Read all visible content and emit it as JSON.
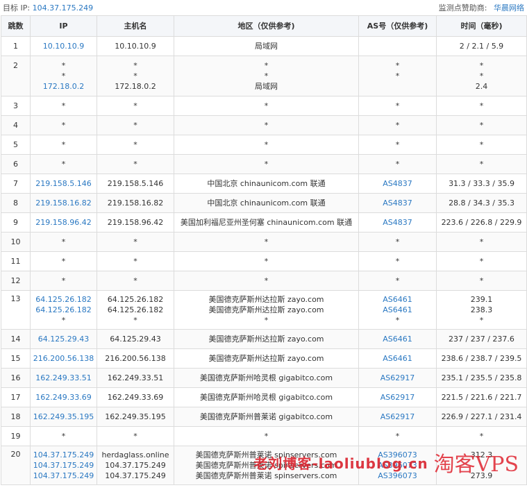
{
  "header": {
    "target_label": "目标 IP:",
    "target_ip": "104.37.175.249",
    "sponsor_label": "监测点赞助商:",
    "sponsor_name": "华晨网络"
  },
  "table": {
    "columns": [
      "跳数",
      "IP",
      "主机名",
      "地区（仅供参考)",
      "AS号（仅供参考)",
      "时间（毫秒)"
    ],
    "rows": [
      {
        "hop": "1",
        "ip": [
          "10.10.10.9"
        ],
        "host": [
          "10.10.10.9"
        ],
        "region": [
          "局域网"
        ],
        "as": [
          ""
        ],
        "time": [
          "2 / 2.1 / 5.9"
        ]
      },
      {
        "hop": "2",
        "ip": [
          "*",
          "*",
          "172.18.0.2"
        ],
        "host": [
          "*",
          "*",
          "172.18.0.2"
        ],
        "region": [
          "*",
          "*",
          "局域网"
        ],
        "as": [
          "*",
          "*",
          ""
        ],
        "time": [
          "*",
          "*",
          "2.4"
        ]
      },
      {
        "hop": "3",
        "ip": [
          "*"
        ],
        "host": [
          "*"
        ],
        "region": [
          "*"
        ],
        "as": [
          "*"
        ],
        "time": [
          "*"
        ]
      },
      {
        "hop": "4",
        "ip": [
          "*"
        ],
        "host": [
          "*"
        ],
        "region": [
          "*"
        ],
        "as": [
          "*"
        ],
        "time": [
          "*"
        ]
      },
      {
        "hop": "5",
        "ip": [
          "*"
        ],
        "host": [
          "*"
        ],
        "region": [
          "*"
        ],
        "as": [
          "*"
        ],
        "time": [
          "*"
        ]
      },
      {
        "hop": "6",
        "ip": [
          "*"
        ],
        "host": [
          "*"
        ],
        "region": [
          "*"
        ],
        "as": [
          "*"
        ],
        "time": [
          "*"
        ]
      },
      {
        "hop": "7",
        "ip": [
          "219.158.5.146"
        ],
        "host": [
          "219.158.5.146"
        ],
        "region": [
          "中国北京 chinaunicom.com 联通"
        ],
        "as": [
          "AS4837"
        ],
        "time": [
          "31.3 / 33.3 / 35.9"
        ]
      },
      {
        "hop": "8",
        "ip": [
          "219.158.16.82"
        ],
        "host": [
          "219.158.16.82"
        ],
        "region": [
          "中国北京 chinaunicom.com 联通"
        ],
        "as": [
          "AS4837"
        ],
        "time": [
          "28.8 / 34.3 / 35.3"
        ]
      },
      {
        "hop": "9",
        "ip": [
          "219.158.96.42"
        ],
        "host": [
          "219.158.96.42"
        ],
        "region": [
          "美国加利福尼亚州圣何塞 chinaunicom.com 联通"
        ],
        "as": [
          "AS4837"
        ],
        "time": [
          "223.6 / 226.8 / 229.9"
        ]
      },
      {
        "hop": "10",
        "ip": [
          "*"
        ],
        "host": [
          "*"
        ],
        "region": [
          "*"
        ],
        "as": [
          "*"
        ],
        "time": [
          "*"
        ]
      },
      {
        "hop": "11",
        "ip": [
          "*"
        ],
        "host": [
          "*"
        ],
        "region": [
          "*"
        ],
        "as": [
          "*"
        ],
        "time": [
          "*"
        ]
      },
      {
        "hop": "12",
        "ip": [
          "*"
        ],
        "host": [
          "*"
        ],
        "region": [
          "*"
        ],
        "as": [
          "*"
        ],
        "time": [
          "*"
        ]
      },
      {
        "hop": "13",
        "ip": [
          "64.125.26.182",
          "64.125.26.182",
          "*"
        ],
        "host": [
          "64.125.26.182",
          "64.125.26.182",
          "*"
        ],
        "region": [
          "美国德克萨斯州达拉斯 zayo.com",
          "美国德克萨斯州达拉斯 zayo.com",
          "*"
        ],
        "as": [
          "AS6461",
          "AS6461",
          "*"
        ],
        "time": [
          "239.1",
          "238.3",
          "*"
        ]
      },
      {
        "hop": "14",
        "ip": [
          "64.125.29.43"
        ],
        "host": [
          "64.125.29.43"
        ],
        "region": [
          "美国德克萨斯州达拉斯 zayo.com"
        ],
        "as": [
          "AS6461"
        ],
        "time": [
          "237 / 237 / 237.6"
        ]
      },
      {
        "hop": "15",
        "ip": [
          "216.200.56.138"
        ],
        "host": [
          "216.200.56.138"
        ],
        "region": [
          "美国德克萨斯州达拉斯 zayo.com"
        ],
        "as": [
          "AS6461"
        ],
        "time": [
          "238.6 / 238.7 / 239.5"
        ]
      },
      {
        "hop": "16",
        "ip": [
          "162.249.33.51"
        ],
        "host": [
          "162.249.33.51"
        ],
        "region": [
          "美国德克萨斯州哈灵根 gigabitco.com"
        ],
        "as": [
          "AS62917"
        ],
        "time": [
          "235.1 / 235.5 / 235.8"
        ]
      },
      {
        "hop": "17",
        "ip": [
          "162.249.33.69"
        ],
        "host": [
          "162.249.33.69"
        ],
        "region": [
          "美国德克萨斯州哈灵根 gigabitco.com"
        ],
        "as": [
          "AS62917"
        ],
        "time": [
          "221.5 / 221.6 / 221.7"
        ]
      },
      {
        "hop": "18",
        "ip": [
          "162.249.35.195"
        ],
        "host": [
          "162.249.35.195"
        ],
        "region": [
          "美国德克萨斯州普莱诺 gigabitco.com"
        ],
        "as": [
          "AS62917"
        ],
        "time": [
          "226.9 / 227.1 / 231.4"
        ]
      },
      {
        "hop": "19",
        "ip": [
          "*"
        ],
        "host": [
          "*"
        ],
        "region": [
          "*"
        ],
        "as": [
          "*"
        ],
        "time": [
          "*"
        ]
      },
      {
        "hop": "20",
        "ip": [
          "104.37.175.249",
          "104.37.175.249",
          "104.37.175.249"
        ],
        "host": [
          "herdaglass.online",
          "104.37.175.249",
          "104.37.175.249"
        ],
        "region": [
          "美国德克萨斯州普莱诺 spinservers.com",
          "美国德克萨斯州普莱诺 spinservers.com",
          "美国德克萨斯州普莱诺 spinservers.com"
        ],
        "as": [
          "AS396073",
          "AS396073",
          "AS396073"
        ],
        "time": [
          "312.3",
          "",
          "273.9"
        ]
      }
    ]
  },
  "watermark": {
    "text": "老刘博客-laoliublog.cn",
    "logo": "淘客VPS"
  }
}
